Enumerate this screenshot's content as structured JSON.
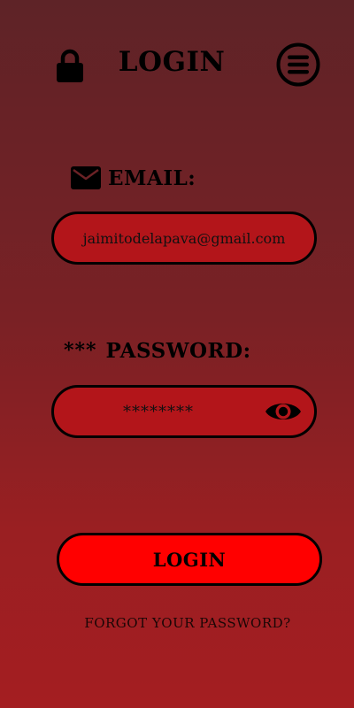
{
  "header": {
    "title": "LOGIN",
    "lock_icon": "lock-icon",
    "menu_icon": "hamburger-menu-icon"
  },
  "email": {
    "label": "EMAIL:",
    "icon": "envelope-icon",
    "value": "jaimitodelapava@gmail.com",
    "placeholder": ""
  },
  "password": {
    "label": "PASSWORD:",
    "label_prefix": "***",
    "value": "********",
    "placeholder": "",
    "visibility_icon": "eye-icon"
  },
  "actions": {
    "login_label": "LOGIN",
    "forgot_label": "FORGOT YOUR PASSWORD?"
  },
  "colors": {
    "background_top": "#5e2327",
    "background_bottom": "#a41e21",
    "field_fill": "#b3151a",
    "button_fill": "#ff0000",
    "border": "#000000"
  }
}
